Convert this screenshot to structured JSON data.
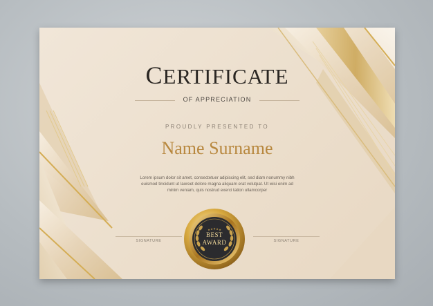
{
  "certificate": {
    "title_initial": "C",
    "title_rest": "ERTIFICATE",
    "subtitle": "OF APPRECIATION",
    "presented_to": "PROUDLY PRESENTED TO",
    "recipient_name": "Name Surname",
    "body_line_1": "Lorem ipsum dolor sit amet, consectetuer adipiscing elit, sed diam nonummy nibh",
    "body_line_2": "euismod tincidunt ut laoreet dolore magna aliquam erat volutpat. Ut wisi enim ad",
    "body_line_3": "minim veniam, quis nostrud exerci tation ullamcorper",
    "signature_left": "SIGNATURE",
    "signature_right": "SIGNATURE",
    "badge_line_1": "BEST",
    "badge_line_2": "AWARD"
  },
  "colors": {
    "background": "#b6bcc0",
    "paper": "#ecdfcd",
    "gold": "#c9a24e",
    "name": "#b8883f",
    "badge_center": "#2b2b2e"
  }
}
